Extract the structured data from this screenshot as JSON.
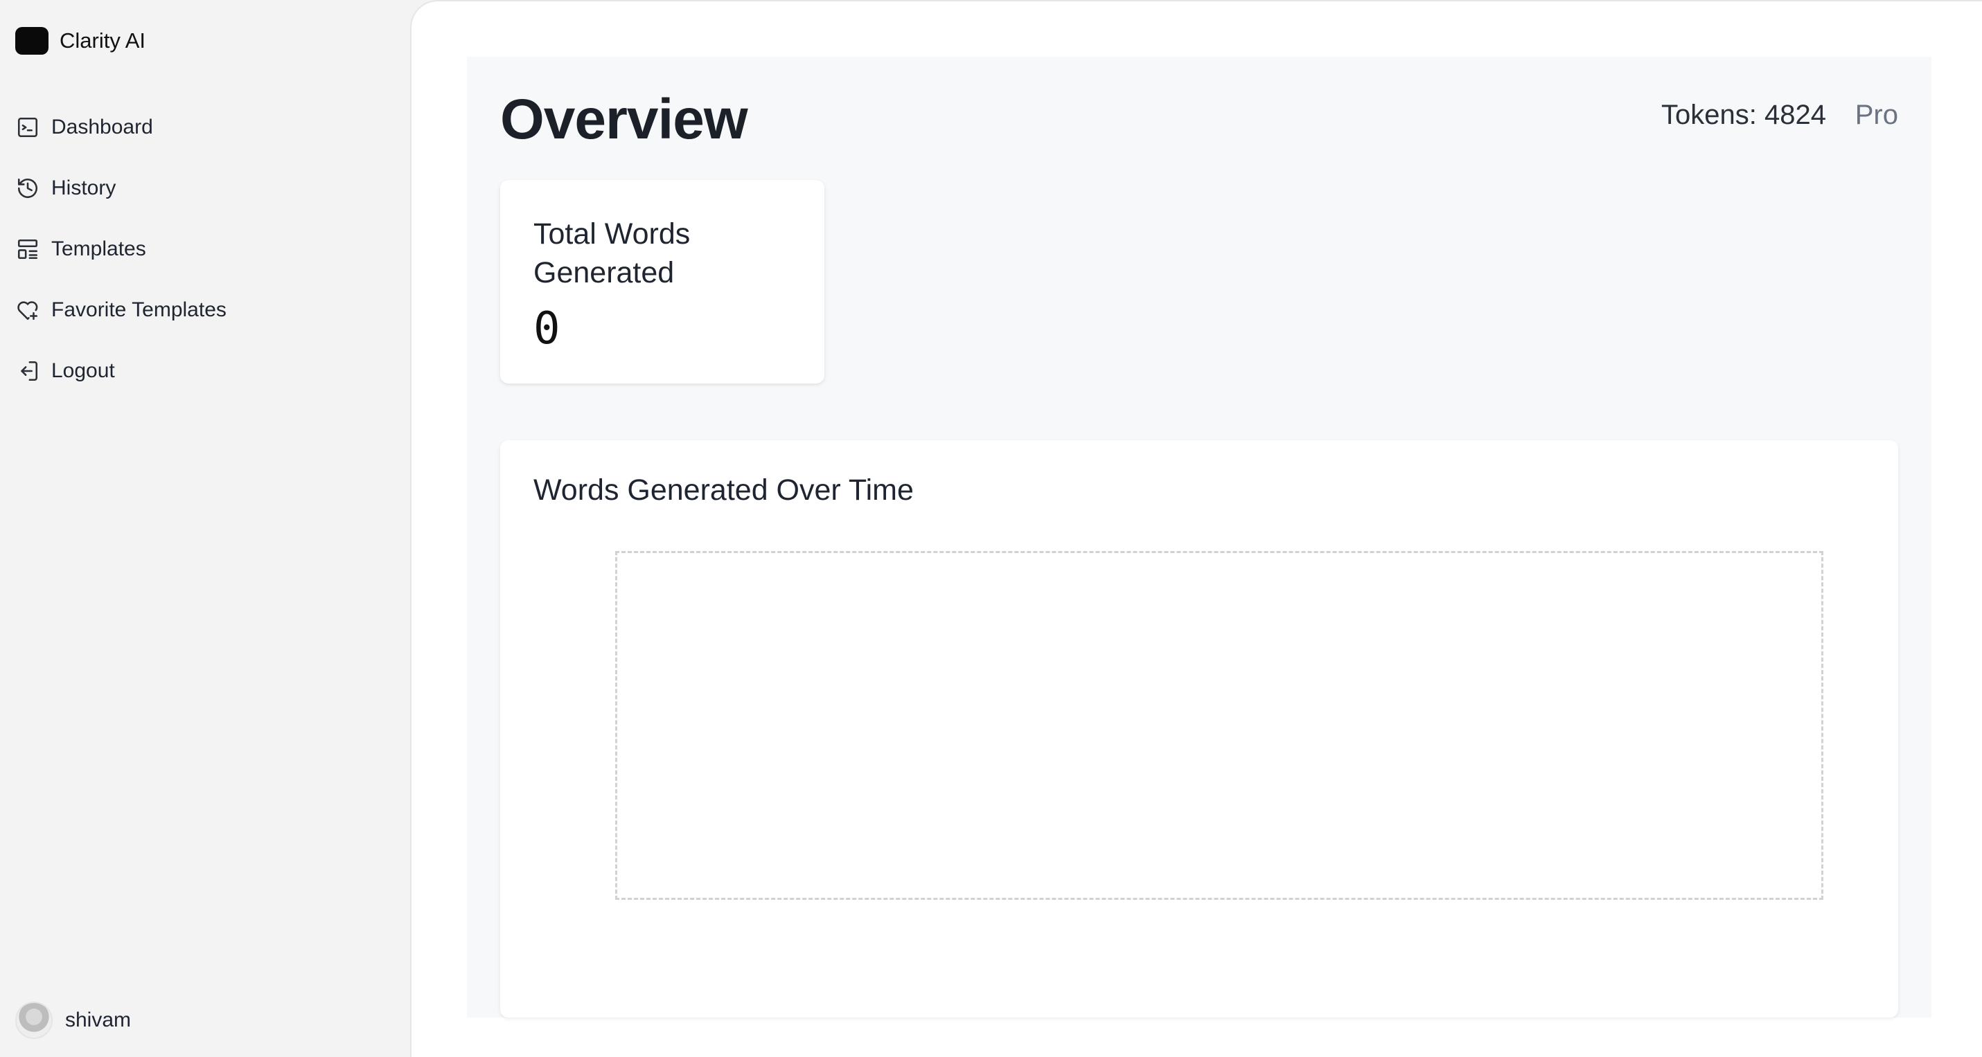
{
  "brand": {
    "name": "Clarity AI"
  },
  "sidebar": {
    "items": [
      {
        "label": "Dashboard",
        "icon": "terminal-square-icon"
      },
      {
        "label": "History",
        "icon": "history-icon"
      },
      {
        "label": "Templates",
        "icon": "layout-template-icon"
      },
      {
        "label": "Favorite Templates",
        "icon": "heart-plus-icon"
      },
      {
        "label": "Logout",
        "icon": "logout-icon"
      }
    ]
  },
  "user": {
    "name": "shivam"
  },
  "header": {
    "title": "Overview",
    "tokens": "Tokens: 4824",
    "plan": "Pro"
  },
  "stats": {
    "total_words_label": "Total Words Generated",
    "total_words_value": "0"
  },
  "chart": {
    "title": "Words Generated Over Time"
  }
}
